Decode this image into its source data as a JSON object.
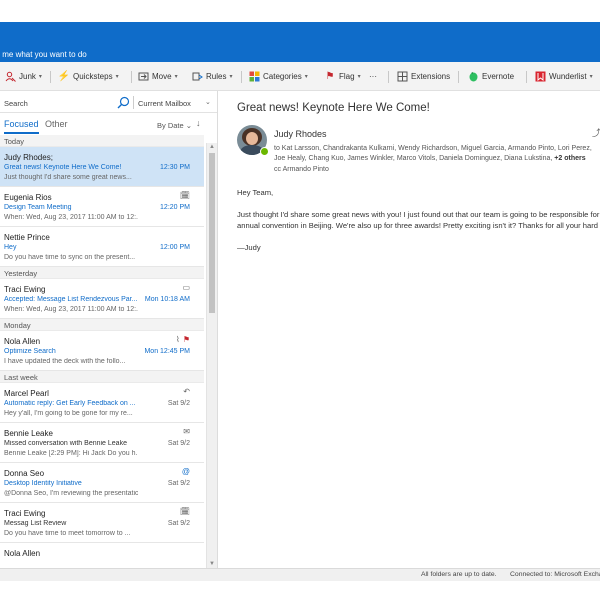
{
  "titlebar": {
    "tell_me": "Tell me what you want to do"
  },
  "toolbar": {
    "junk": "Junk",
    "quicksteps": "Quicksteps",
    "move": "Move",
    "rules": "Rules",
    "categories": "Categories",
    "flag": "Flag",
    "more": "···",
    "extensions": "Extensions",
    "evernote": "Evernote",
    "wunderlist": "Wunderlist"
  },
  "search": {
    "label": "Search",
    "scope": "Current Mailbox"
  },
  "tabs": {
    "focused": "Focused",
    "other": "Other",
    "sort": "By Date"
  },
  "groups": {
    "today": "Today",
    "yesterday": "Yesterday",
    "monday": "Monday",
    "last_week": "Last week"
  },
  "messages": [
    {
      "from": "Judy Rhodes;",
      "subject": "Great news! Keynote Here We Come!",
      "time": "12:30 PM",
      "preview": "Just thought I'd share some great news..."
    },
    {
      "from": "Eugenia Rios",
      "subject": "Design Team Meeting",
      "time": "12:20 PM",
      "preview": "When: Wed, Aug 23, 2017 11:00 AM to 12:..."
    },
    {
      "from": "Nettie Prince",
      "subject": "Hey",
      "time": "12:00 PM",
      "preview": "Do you have time to sync on the present..."
    },
    {
      "from": "Traci Ewing",
      "subject": "Accepted: Message List Rendezvous Par...",
      "time": "Mon 10:18 AM",
      "preview": "When: Wed, Aug 23, 2017 11:00 AM to 12:..."
    },
    {
      "from": "Nola Allen",
      "subject": "Optimize Search",
      "time": "Mon 12:45 PM",
      "preview": "I have updated the deck with the follo..."
    },
    {
      "from": "Marcel Pearl",
      "subject": "Automatic reply: Get Early Feedback on ...",
      "time": "Sat 9/2",
      "preview": "Hey y'all, I'm going to be gone for my re..."
    },
    {
      "from": "Bennie Leake",
      "subject": "Missed conversation with Bennie Leake",
      "time": "Sat 9/2",
      "preview": "Bennie Leake [2:29 PM]: Hi Jack Do you h..."
    },
    {
      "from": "Donna Seo",
      "subject": "Desktop Identity Initiative",
      "time": "Sat 9/2",
      "preview": "@Donna Seo, I'm reviewing the presentation ..."
    },
    {
      "from": "Traci Ewing",
      "subject": "Messag List Review",
      "time": "Sat 9/2",
      "preview": "Do you have time to meet tomorrow to ..."
    },
    {
      "from": "Nola Allen",
      "subject": "",
      "time": "",
      "preview": ""
    }
  ],
  "reading": {
    "subject": "Great news! Keynote Here We Come!",
    "sender": "Judy Rhodes",
    "to_prefix": "to",
    "to_list": "Kat Larsson, Chandrakanta Kulkarni, Wendy Richardson, Miguel Garcia, Armando Pinto, Lori Perez, Joe Healy, Chang Kuo, James Winkler, Marco Vitols, Daniela Dominguez, Diana Lukstina,",
    "to_more": "+2 others",
    "cc_prefix": "cc",
    "cc_list": "Armando Pinto",
    "greeting": "Hey Team,",
    "body_line1": "Just thought I'd share some great news with you! I just found out that our team is going to be responsible for the keynote at the",
    "body_line2": "annual convention in Beijing. We're also up for three awards! Pretty exciting isn't it? Thanks for all your hard work!",
    "signature": "—Judy"
  },
  "status": {
    "folders": "All folders are up to date.",
    "connection": "Connected to: Microsoft Exchange"
  },
  "colors": {
    "accent": "#0f6cc9",
    "selected_row": "#cfe3f6",
    "flag": "#c4262e",
    "presence": "#6bb700"
  }
}
